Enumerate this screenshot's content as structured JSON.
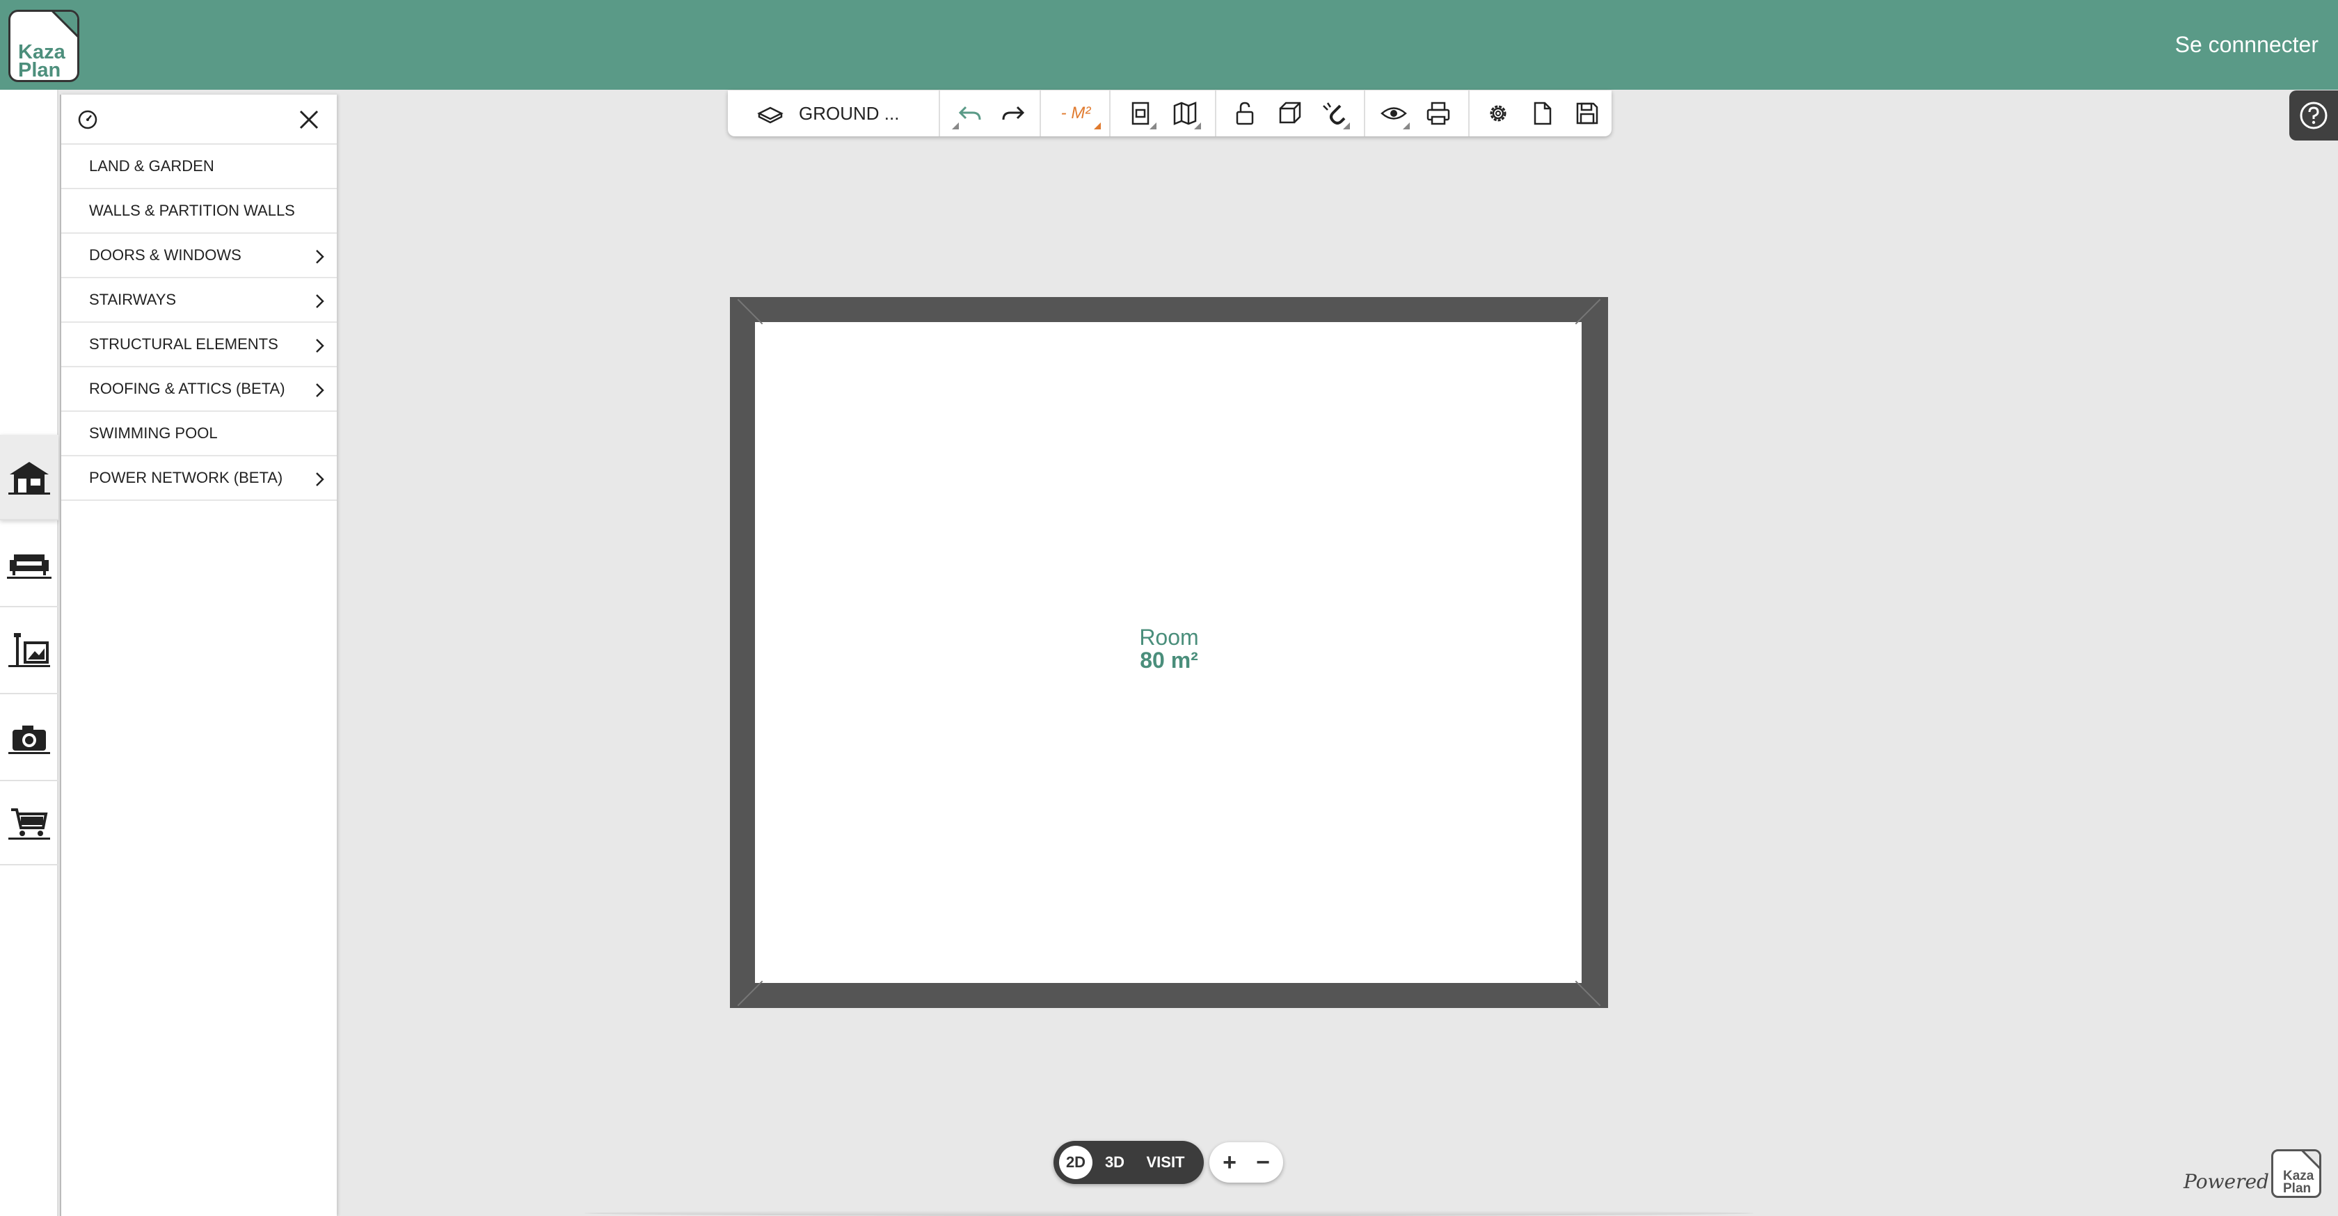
{
  "header": {
    "logo_line1": "Kaza",
    "logo_line2": "Plan",
    "login_label": "Se connnecter"
  },
  "rail": {
    "items": [
      {
        "name": "building",
        "icon": "house-icon",
        "active": true
      },
      {
        "name": "furniture",
        "icon": "sofa-icon",
        "active": false
      },
      {
        "name": "decoration",
        "icon": "lamp-painting-icon",
        "active": false
      },
      {
        "name": "photo",
        "icon": "camera-icon",
        "active": false
      },
      {
        "name": "shop",
        "icon": "cart-icon",
        "active": false
      }
    ]
  },
  "menu": {
    "items": [
      {
        "label": "LAND & GARDEN",
        "has_submenu": false
      },
      {
        "label": "WALLS & PARTITION WALLS",
        "has_submenu": false
      },
      {
        "label": "DOORS & WINDOWS",
        "has_submenu": true
      },
      {
        "label": "STAIRWAYS",
        "has_submenu": true
      },
      {
        "label": "STRUCTURAL ELEMENTS",
        "has_submenu": true
      },
      {
        "label": "ROOFING & ATTICS (BETA)",
        "has_submenu": true
      },
      {
        "label": "SWIMMING POOL",
        "has_submenu": false
      },
      {
        "label": "POWER NETWORK (BETA)",
        "has_submenu": true
      }
    ]
  },
  "toolbar": {
    "level_label": "GROUND ...",
    "area_label": "- M²",
    "accent_color": "#e07a2e",
    "undo_color": "#5a9a87"
  },
  "plan": {
    "room_name": "Room",
    "room_area": "80 m²",
    "label_color": "#4a8e7b"
  },
  "view_switch": {
    "options": [
      "2D",
      "3D",
      "VISIT"
    ],
    "active": "2D"
  },
  "zoom": {
    "plus": "+",
    "minus": "−"
  },
  "footer": {
    "powered_by": "Powered by",
    "logo_line1": "Kaza",
    "logo_line2": "Plan"
  },
  "colors": {
    "brand": "#5a9a87",
    "canvas": "#e8e8e8",
    "wall": "#555555"
  }
}
